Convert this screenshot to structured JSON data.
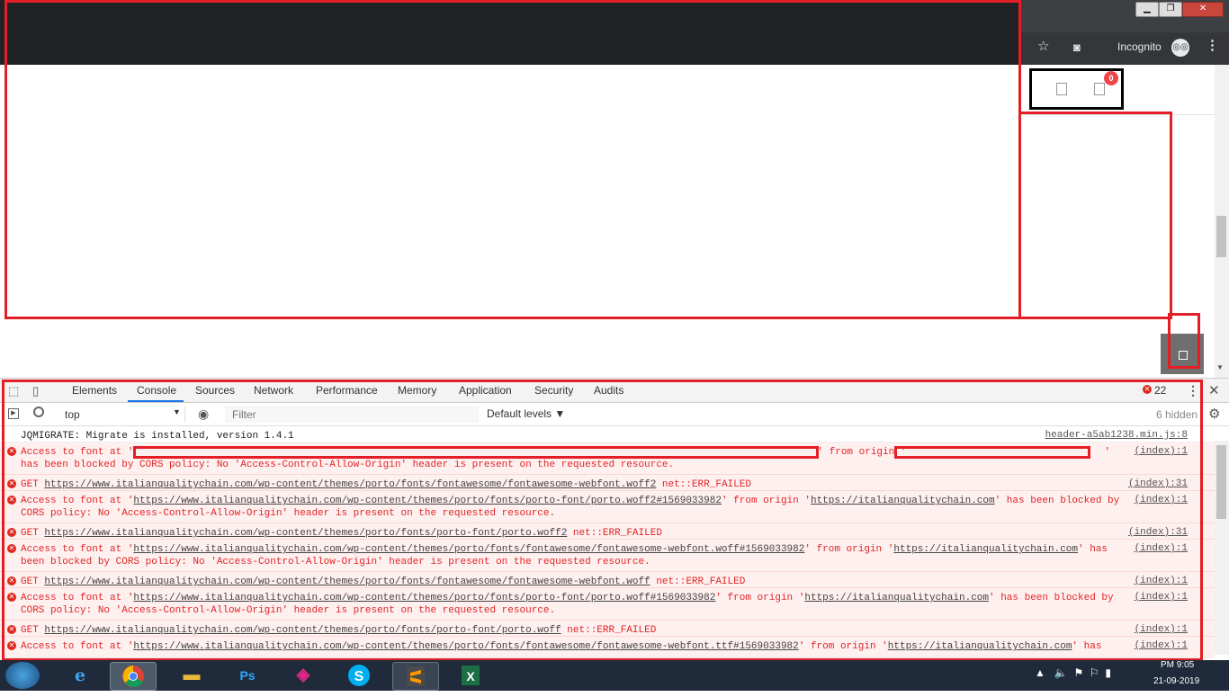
{
  "browser": {
    "incognito_label": "Incognito",
    "window_controls": {
      "minimize": "▁",
      "maximize": "❐",
      "close": "✕"
    }
  },
  "page": {
    "cart_count": "0"
  },
  "devtools": {
    "tabs": [
      "Elements",
      "Console",
      "Sources",
      "Network",
      "Performance",
      "Memory",
      "Application",
      "Security",
      "Audits"
    ],
    "active_tab": "Console",
    "error_count": "22",
    "context": "top",
    "filter_placeholder": "Filter",
    "levels_label": "Default levels ▼",
    "hidden_count": "6 hidden",
    "log": [
      {
        "level": "info",
        "msg": "JQMIGRATE: Migrate is installed, version 1.4.1",
        "source": "header-a5ab1238.min.js:8"
      },
      {
        "level": "error",
        "msg": "Access to font at '",
        "msg_mid": "' from origin '",
        "msg_end": "' has been blocked by CORS policy: No 'Access-Control-Allow-Origin' header is present on the requested resource.",
        "source": "(index):1",
        "redacted": true
      },
      {
        "level": "error",
        "msg_pre": "GET ",
        "url": "https://www.italianqualitychain.com/wp-content/themes/porto/fonts/fontawesome/fontawesome-webfont.woff2",
        "msg_post": " net::ERR_FAILED",
        "source": "(index):31"
      },
      {
        "level": "error",
        "msg_pre": "Access to font at '",
        "url": "https://www.italianqualitychain.com/wp-content/themes/porto/fonts/porto-font/porto.woff2#1569033982",
        "msg_mid": "' from origin '",
        "origin": "https://italianqualitychain.com",
        "msg_post": "' has been blocked by CORS policy: No 'Access-Control-Allow-Origin' header is present on the requested resource.",
        "source": "(index):1"
      },
      {
        "level": "error",
        "msg_pre": "GET ",
        "url": "https://www.italianqualitychain.com/wp-content/themes/porto/fonts/porto-font/porto.woff2",
        "msg_post": " net::ERR_FAILED",
        "source": "(index):31"
      },
      {
        "level": "error",
        "msg_pre": "Access to font at '",
        "url": "https://www.italianqualitychain.com/wp-content/themes/porto/fonts/fontawesome/fontawesome-webfont.woff#1569033982",
        "msg_mid": "' from origin '",
        "origin": "https://italianqualitychain.com",
        "msg_post": "' has been blocked by CORS policy: No 'Access-Control-Allow-Origin' header is present on the requested resource.",
        "source": "(index):1"
      },
      {
        "level": "error",
        "msg_pre": "GET ",
        "url": "https://www.italianqualitychain.com/wp-content/themes/porto/fonts/fontawesome/fontawesome-webfont.woff",
        "msg_post": " net::ERR_FAILED",
        "source": "(index):1"
      },
      {
        "level": "error",
        "msg_pre": "Access to font at '",
        "url": "https://www.italianqualitychain.com/wp-content/themes/porto/fonts/porto-font/porto.woff#1569033982",
        "msg_mid": "' from origin '",
        "origin": "https://italianqualitychain.com",
        "msg_post": "' has been blocked by CORS policy: No 'Access-Control-Allow-Origin' header is present on the requested resource.",
        "source": "(index):1"
      },
      {
        "level": "error",
        "msg_pre": "GET ",
        "url": "https://www.italianqualitychain.com/wp-content/themes/porto/fonts/porto-font/porto.woff",
        "msg_post": " net::ERR_FAILED",
        "source": "(index):1"
      },
      {
        "level": "error",
        "msg_pre": "Access to font at '",
        "url": "https://www.italianqualitychain.com/wp-content/themes/porto/fonts/fontawesome/fontawesome-webfont.ttf#1569033982",
        "msg_mid": "' from origin '",
        "origin": "https://italianqualitychain.com",
        "msg_post": "' has",
        "source": "(index):1"
      }
    ]
  },
  "taskbar": {
    "clock_time": "PM 9:05",
    "clock_date": "21-09-2019",
    "apps": [
      "internet-explorer",
      "chrome",
      "file-explorer",
      "photoshop",
      "app5",
      "skype",
      "sublime-text",
      "excel"
    ]
  },
  "colors": {
    "error": "#e02626",
    "redaction": "#e31e24",
    "accent": "#1a73e8"
  }
}
